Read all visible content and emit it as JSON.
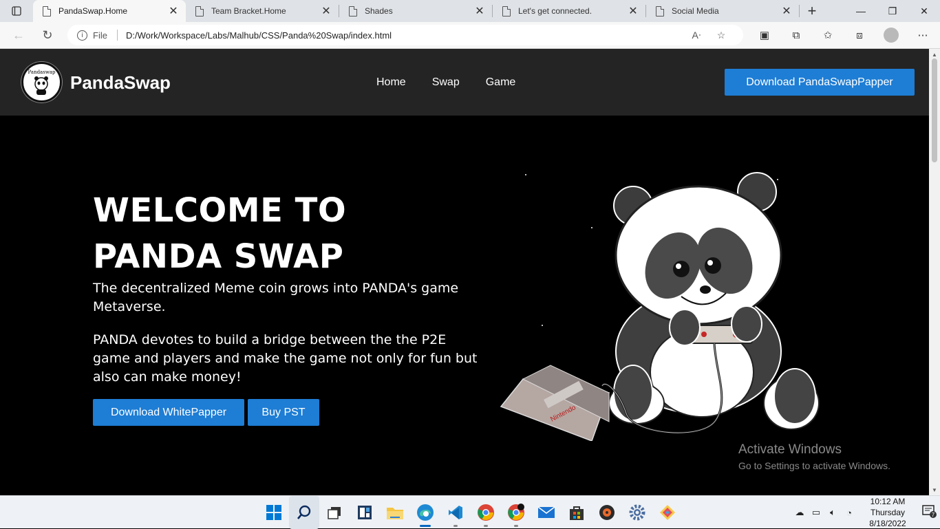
{
  "browser": {
    "tabs": [
      {
        "label": "PandaSwap.Home",
        "active": true
      },
      {
        "label": "Team Bracket.Home",
        "active": false
      },
      {
        "label": "Shades",
        "active": false
      },
      {
        "label": "Let's get connected.",
        "active": false
      },
      {
        "label": "Social Media",
        "active": false
      }
    ],
    "address": {
      "scheme_label": "File",
      "url": "D:/Work/Workspace/Labs/Malhub/CSS/Panda%20Swap/index.html"
    }
  },
  "site": {
    "logo_text": "Pandaswap",
    "brand": "PandaSwap",
    "nav": [
      "Home",
      "Swap",
      "Game"
    ],
    "nav_cta": "Download PandaSwapPapper",
    "hero": {
      "title": "WELCOME TO PANDA SWAP",
      "subtitle": "The decentralized Meme coin grows into PANDA's game Metaverse.",
      "body": "PANDA devotes to build a bridge between the the P2E game and players and make the game not only for fun but also can make money!",
      "btn_whitepaper": "Download WhitePapper",
      "btn_buy": "Buy PST"
    },
    "console_label": "Nintendo"
  },
  "watermark": {
    "line1": "Activate Windows",
    "line2": "Go to Settings to activate Windows."
  },
  "taskbar": {
    "apps": [
      "start",
      "search",
      "task-view",
      "widgets",
      "file-explorer",
      "edge",
      "vscode",
      "chrome",
      "chrome-profile",
      "mail",
      "store",
      "media-player",
      "settings",
      "git-app"
    ],
    "clock": {
      "time": "10:12 AM",
      "day": "Thursday",
      "date": "8/18/2022"
    },
    "notification_count": "7"
  },
  "colors": {
    "accent_button": "#1e7dd4",
    "nav_bg": "#242424",
    "page_bg": "#000000"
  }
}
